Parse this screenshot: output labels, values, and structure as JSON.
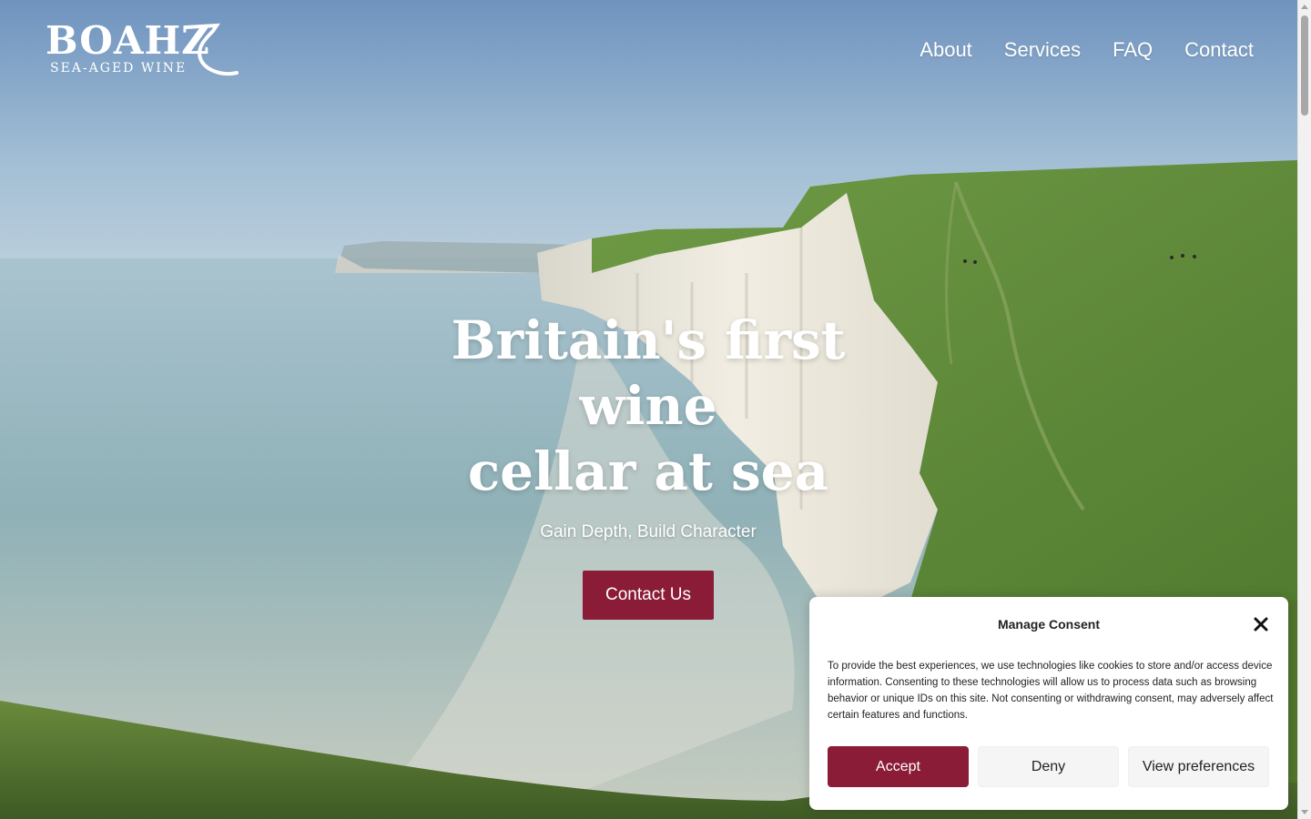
{
  "header": {
    "logo": {
      "wordmark": "BOAHZ",
      "tagline": "SEA-AGED WINE"
    },
    "nav": [
      {
        "label": "About"
      },
      {
        "label": "Services"
      },
      {
        "label": "FAQ"
      },
      {
        "label": "Contact"
      }
    ]
  },
  "hero": {
    "title_line1": "Britain's first wine",
    "title_line2": "cellar at sea",
    "subtitle": "Gain Depth, Build Character",
    "cta_label": "Contact Us",
    "background_image": "coastal-chalk-cliffs-photo"
  },
  "consent": {
    "title": "Manage Consent",
    "body": "To provide the best experiences, we use technologies like cookies to store and/or access device information. Consenting to these technologies will allow us to process data such as browsing behavior or unique IDs on this site. Not consenting or withdrawing consent, may adversely affect certain features and functions.",
    "close_icon": "close-icon",
    "buttons": {
      "accept": "Accept",
      "deny": "Deny",
      "preferences": "View preferences"
    }
  },
  "colors": {
    "brand_accent": "#8a1c37",
    "text_on_hero": "#ffffff",
    "sky_top": "#6f93bf",
    "sea": "#8fb3b9",
    "grass": "#5d8a3a",
    "cliff": "#ece8dc"
  }
}
